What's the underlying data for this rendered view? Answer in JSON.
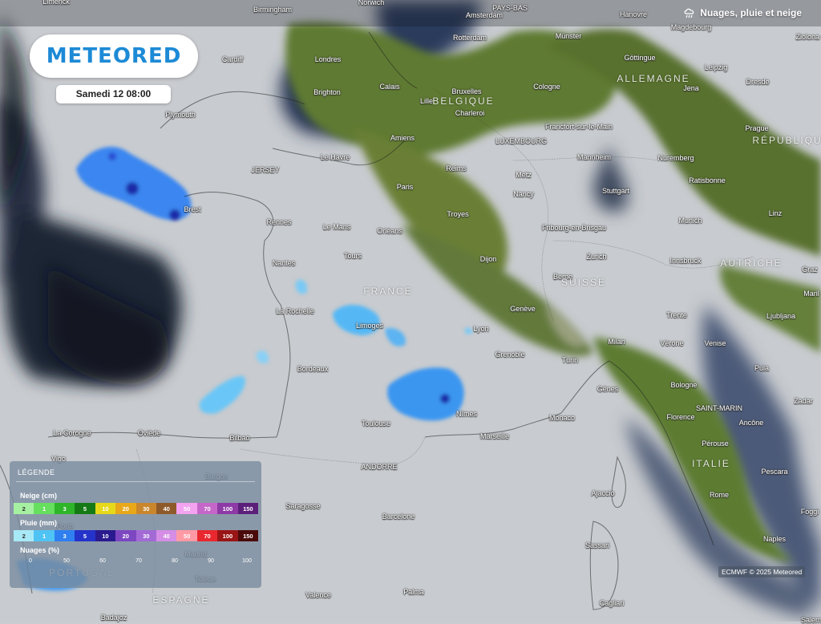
{
  "brand": {
    "logo_text": "METEORED"
  },
  "date_label": "Samedi 12 08:00",
  "layer": {
    "title": "Nuages, pluie et neige",
    "icon": "cloud-rain-icon"
  },
  "credit": "ECMWF © 2025 Meteored",
  "cities": [
    {
      "name": "Limerick"
    },
    {
      "name": "Birmingham"
    },
    {
      "name": "Norwich"
    },
    {
      "name": "Amsterdam"
    },
    {
      "name": "PAYS-BAS"
    },
    {
      "name": "Hanovre"
    },
    {
      "name": "Magdebourg"
    },
    {
      "name": "Ziolona G"
    },
    {
      "name": "Rotterdam"
    },
    {
      "name": "Münster"
    },
    {
      "name": "Cardiff"
    },
    {
      "name": "Londres"
    },
    {
      "name": "Göttingue"
    },
    {
      "name": "Leipzig"
    },
    {
      "name": "Dresde"
    },
    {
      "name": "Jena"
    },
    {
      "name": "Brighton"
    },
    {
      "name": "Calais"
    },
    {
      "name": "Bruxelles"
    },
    {
      "name": "Cologne"
    },
    {
      "name": "Plymouth"
    },
    {
      "name": "Lille"
    },
    {
      "name": "Charleroi"
    },
    {
      "name": "Prague"
    },
    {
      "name": "Francfort-sur-le-Main"
    },
    {
      "name": "Amiens"
    },
    {
      "name": "LUXEMBOURG"
    },
    {
      "name": "Le Havre"
    },
    {
      "name": "Mannheim"
    },
    {
      "name": "Nuremberg"
    },
    {
      "name": "JERSEY"
    },
    {
      "name": "Reims"
    },
    {
      "name": "Metz"
    },
    {
      "name": "Paris"
    },
    {
      "name": "Stuttgart"
    },
    {
      "name": "Ratisbonne"
    },
    {
      "name": "Nancy"
    },
    {
      "name": "Brest"
    },
    {
      "name": "Troyes"
    },
    {
      "name": "Linz"
    },
    {
      "name": "Rennes"
    },
    {
      "name": "Le Mans"
    },
    {
      "name": "Orléans"
    },
    {
      "name": "Fribourg-en-Brisgau"
    },
    {
      "name": "Munich"
    },
    {
      "name": "Tours"
    },
    {
      "name": "Dijon"
    },
    {
      "name": "Zurich"
    },
    {
      "name": "Nantes"
    },
    {
      "name": "Innsbruck"
    },
    {
      "name": "Graz"
    },
    {
      "name": "Berne"
    },
    {
      "name": "Maril"
    },
    {
      "name": "La Rochelle"
    },
    {
      "name": "Genève"
    },
    {
      "name": "Trente"
    },
    {
      "name": "Ljubljana"
    },
    {
      "name": "Limoges"
    },
    {
      "name": "Lyon"
    },
    {
      "name": "Milan"
    },
    {
      "name": "Vérone"
    },
    {
      "name": "Venise"
    },
    {
      "name": "Grenoble"
    },
    {
      "name": "Turin"
    },
    {
      "name": "Pula"
    },
    {
      "name": "Bordeaux"
    },
    {
      "name": "Gênes"
    },
    {
      "name": "Bologne"
    },
    {
      "name": "Zadar"
    },
    {
      "name": "Nîmes"
    },
    {
      "name": "Toulouse"
    },
    {
      "name": "Monaco"
    },
    {
      "name": "SAINT-MARIN"
    },
    {
      "name": "Florence"
    },
    {
      "name": "Ancône"
    },
    {
      "name": "La Corogne"
    },
    {
      "name": "Oviède"
    },
    {
      "name": "Bilbao"
    },
    {
      "name": "Marseille"
    },
    {
      "name": "Vigo"
    },
    {
      "name": "Pérouse"
    },
    {
      "name": "ANDORRE"
    },
    {
      "name": "Burgos"
    },
    {
      "name": "Pescara"
    },
    {
      "name": "Ajaccio"
    },
    {
      "name": "Saragosse"
    },
    {
      "name": "Rome"
    },
    {
      "name": "Foggi"
    },
    {
      "name": "Porto"
    },
    {
      "name": "Barcelone"
    },
    {
      "name": "Sassari"
    },
    {
      "name": "Naples"
    },
    {
      "name": "Madrid"
    },
    {
      "name": "Tolède"
    },
    {
      "name": "Palma"
    },
    {
      "name": "Valence"
    },
    {
      "name": "Cagliari"
    },
    {
      "name": "Badajoz"
    },
    {
      "name": "Salern"
    }
  ],
  "countries": [
    {
      "name": "ALLEMAGNE"
    },
    {
      "name": "BELGIQUE"
    },
    {
      "name": "RÉPUBLIQUE"
    },
    {
      "name": "FRANCE"
    },
    {
      "name": "SUISSE"
    },
    {
      "name": "AUTRICHE"
    },
    {
      "name": "ITALIE"
    },
    {
      "name": "PORTUGAL"
    },
    {
      "name": "ESPAGNE"
    }
  ],
  "legend": {
    "title": "LÉGENDE",
    "snow": {
      "label": "Neige (cm)",
      "stops": [
        {
          "v": "2",
          "c": "#a6f0a2",
          "t": "#333"
        },
        {
          "v": "1",
          "c": "#66de5e",
          "t": "#fff"
        },
        {
          "v": "3",
          "c": "#2eb52a",
          "t": "#fff"
        },
        {
          "v": "5",
          "c": "#157a16",
          "t": "#fff"
        },
        {
          "v": "10",
          "c": "#e6d91a",
          "t": "#fff"
        },
        {
          "v": "20",
          "c": "#e8a81a",
          "t": "#fff"
        },
        {
          "v": "30",
          "c": "#c9862c",
          "t": "#fff"
        },
        {
          "v": "40",
          "c": "#8f5a2a",
          "t": "#fff"
        },
        {
          "v": "50",
          "c": "#f3a3f0",
          "t": "#fff"
        },
        {
          "v": "70",
          "c": "#c567c9",
          "t": "#fff"
        },
        {
          "v": "100",
          "c": "#8d3aa6",
          "t": "#fff"
        },
        {
          "v": "150",
          "c": "#5b1f7a",
          "t": "#fff"
        }
      ]
    },
    "rain": {
      "label": "Pluie (mm)",
      "stops": [
        {
          "v": "2",
          "c": "#a8e9f7",
          "t": "#333"
        },
        {
          "v": "1",
          "c": "#4fc3f4",
          "t": "#fff"
        },
        {
          "v": "3",
          "c": "#2f7ff0",
          "t": "#fff"
        },
        {
          "v": "5",
          "c": "#2433c9",
          "t": "#fff"
        },
        {
          "v": "10",
          "c": "#2a1a8f",
          "t": "#fff"
        },
        {
          "v": "20",
          "c": "#7e47c2",
          "t": "#fff"
        },
        {
          "v": "30",
          "c": "#a36ad6",
          "t": "#fff"
        },
        {
          "v": "40",
          "c": "#d58de6",
          "t": "#fff"
        },
        {
          "v": "50",
          "c": "#ff9aa5",
          "t": "#fff"
        },
        {
          "v": "70",
          "c": "#e8282e",
          "t": "#fff"
        },
        {
          "v": "100",
          "c": "#9a1515",
          "t": "#fff"
        },
        {
          "v": "150",
          "c": "#4a0a0a",
          "t": "#fff"
        }
      ]
    },
    "clouds": {
      "label": "Nuages (%)",
      "ticks": [
        "0",
        "50",
        "60",
        "70",
        "80",
        "90",
        "100"
      ]
    }
  },
  "colors": {
    "sea": "#2c3a54",
    "land": "#c6c9cc",
    "veg": "#5d7a2e",
    "rain": "#3a7be0",
    "logo": "#1d8ad6"
  }
}
